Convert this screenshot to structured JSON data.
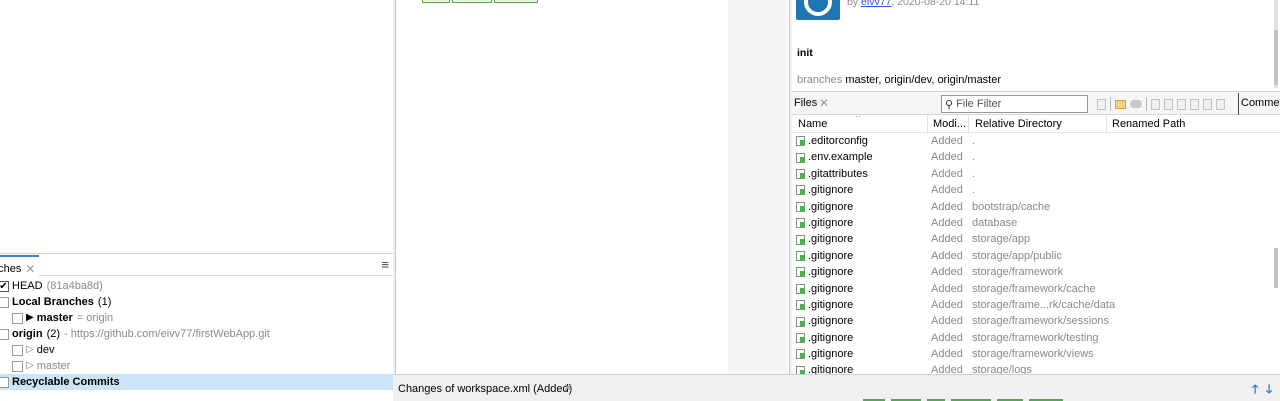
{
  "branches_panel": {
    "tab_label": "nches",
    "items": [
      {
        "label": "HEAD",
        "detail": "(81a4ba8d)",
        "checked": true
      },
      {
        "label": "Local Branches",
        "detail": "(1)"
      },
      {
        "label": "master",
        "detail": "= origin"
      },
      {
        "label": "origin",
        "count": "(2)",
        "detail": "- https://github.com/eivv77/firstWebApp.git"
      },
      {
        "label": "dev"
      },
      {
        "label": "master"
      },
      {
        "label": "Recyclable Commits"
      }
    ]
  },
  "commit_info": {
    "author_prefix": "by",
    "author_name": "eivv77",
    "date_text": ", 2020-08-20 14:11",
    "message": "init",
    "branches_label": "branches",
    "branches_value": "master, origin/dev, origin/master"
  },
  "files_panel": {
    "title": "Files",
    "filter_placeholder": "File Filter",
    "comments_tab": "Commen",
    "columns": [
      "Name",
      "Modi...",
      "Relative Directory",
      "Renamed Path"
    ],
    "rows": [
      {
        "name": ".editorconfig",
        "mod": "Added",
        "dir": "."
      },
      {
        "name": ".env.example",
        "mod": "Added",
        "dir": "."
      },
      {
        "name": ".gitattributes",
        "mod": "Added",
        "dir": "."
      },
      {
        "name": ".gitignore",
        "mod": "Added",
        "dir": "."
      },
      {
        "name": ".gitignore",
        "mod": "Added",
        "dir": "bootstrap/cache"
      },
      {
        "name": ".gitignore",
        "mod": "Added",
        "dir": "database"
      },
      {
        "name": ".gitignore",
        "mod": "Added",
        "dir": "storage/app"
      },
      {
        "name": ".gitignore",
        "mod": "Added",
        "dir": "storage/app/public"
      },
      {
        "name": ".gitignore",
        "mod": "Added",
        "dir": "storage/framework"
      },
      {
        "name": ".gitignore",
        "mod": "Added",
        "dir": "storage/framework/cache"
      },
      {
        "name": ".gitignore",
        "mod": "Added",
        "dir": "storage/frame...rk/cache/data"
      },
      {
        "name": ".gitignore",
        "mod": "Added",
        "dir": "storage/framework/sessions"
      },
      {
        "name": ".gitignore",
        "mod": "Added",
        "dir": "storage/framework/testing"
      },
      {
        "name": ".gitignore",
        "mod": "Added",
        "dir": "storage/framework/views"
      },
      {
        "name": ".gitignore",
        "mod": "Added",
        "dir": "storage/logs"
      }
    ]
  },
  "bottom_panel": {
    "title": "Changes of workspace.xml (Added)"
  },
  "icons": {
    "close": "close-icon",
    "menu": "hamburger-menu-icon",
    "search": "search-icon",
    "file_added": "file-added-icon",
    "nav_up": "arrow-up-icon",
    "nav_down": "arrow-down-icon"
  },
  "colors": {
    "selection": "#cce4f7",
    "accent": "#3b7fd4",
    "link": "#1a5fd0",
    "avatar": "#1f74b3"
  }
}
